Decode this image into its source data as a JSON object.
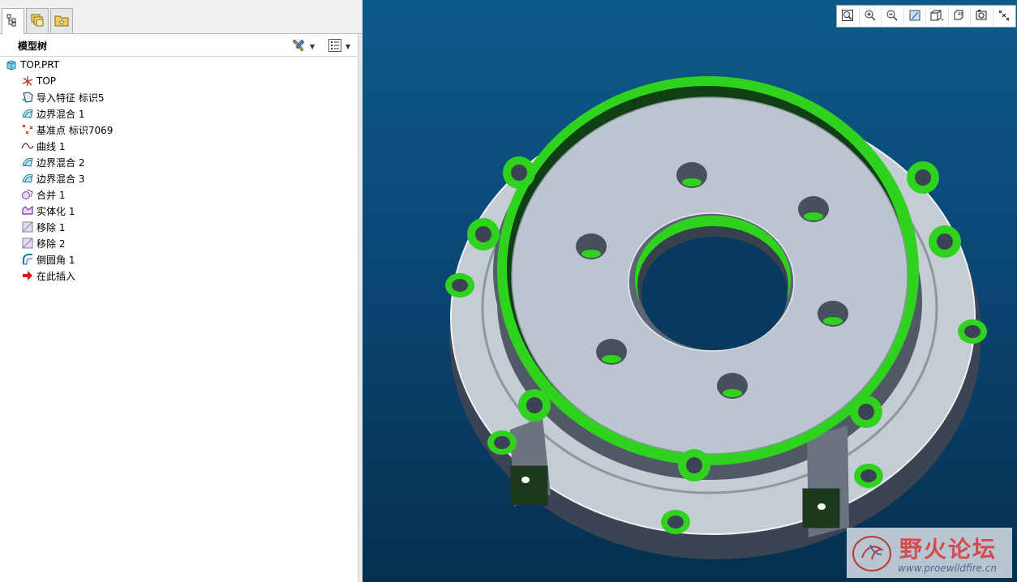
{
  "tabs": [
    {
      "name": "model-tree-tab",
      "icon": "model-tree-icon"
    },
    {
      "name": "layer-tree-tab",
      "icon": "layers-icon"
    },
    {
      "name": "favorites-tab",
      "icon": "folder-star-icon"
    }
  ],
  "tree_header": {
    "title": "模型树",
    "settings_icon": "tree-settings-icon",
    "show_icon": "tree-columns-icon"
  },
  "tree": {
    "root": "TOP.PRT",
    "items": [
      {
        "label": "TOP",
        "icon": "datum-csys-icon"
      },
      {
        "label": "导入特征 标识5",
        "icon": "import-feature-icon"
      },
      {
        "label": "边界混合 1",
        "icon": "boundary-blend-icon"
      },
      {
        "label": "基准点 标识7069",
        "icon": "datum-point-icon"
      },
      {
        "label": "曲线 1",
        "icon": "curve-icon"
      },
      {
        "label": "边界混合 2",
        "icon": "boundary-blend-icon"
      },
      {
        "label": "边界混合 3",
        "icon": "boundary-blend-icon"
      },
      {
        "label": "合并 1",
        "icon": "merge-icon"
      },
      {
        "label": "实体化 1",
        "icon": "solidify-icon"
      },
      {
        "label": "移除 1",
        "icon": "remove-icon"
      },
      {
        "label": "移除 2",
        "icon": "remove-icon"
      },
      {
        "label": "倒圆角 1",
        "icon": "round-icon"
      },
      {
        "label": "在此插入",
        "icon": "insert-here-arrow-icon"
      }
    ]
  },
  "view_toolbar": [
    {
      "name": "refit-button",
      "icon": "refit-icon"
    },
    {
      "name": "zoom-in-button",
      "icon": "zoom-in-icon"
    },
    {
      "name": "zoom-out-button",
      "icon": "zoom-out-icon"
    },
    {
      "name": "repaint-button",
      "icon": "repaint-icon"
    },
    {
      "name": "display-style-button",
      "icon": "shaded-cube-icon"
    },
    {
      "name": "saved-views-button",
      "icon": "saved-views-icon"
    },
    {
      "name": "view-manager-button",
      "icon": "view-manager-icon"
    },
    {
      "name": "datum-display-button",
      "icon": "datum-display-icon"
    }
  ],
  "watermark": {
    "title": "野火论坛",
    "url": "www.proewildfire.cn"
  },
  "colors": {
    "viewport_top": "#0d5a8a",
    "viewport_bottom": "#06304f",
    "highlight_green": "#33dd22",
    "part_gray": "#b9c2cc"
  }
}
